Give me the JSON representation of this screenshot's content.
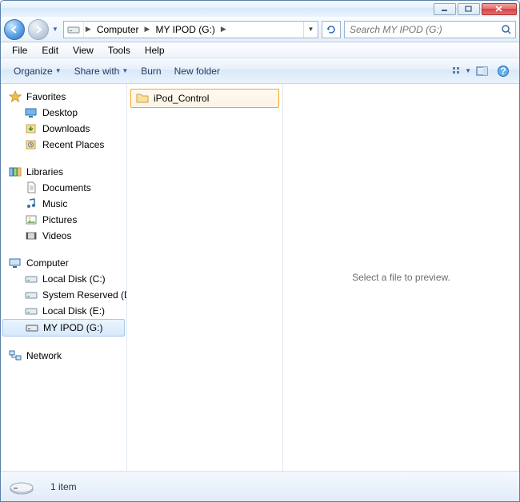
{
  "window_controls": {
    "min": "minimize",
    "max": "maximize",
    "close": "close"
  },
  "address": {
    "segments": [
      "Computer",
      "MY IPOD (G:)"
    ]
  },
  "search": {
    "placeholder": "Search MY IPOD (G:)"
  },
  "menubar": {
    "file": "File",
    "edit": "Edit",
    "view": "View",
    "tools": "Tools",
    "help": "Help"
  },
  "toolbar": {
    "organize": "Organize",
    "share": "Share with",
    "burn": "Burn",
    "newfolder": "New folder"
  },
  "sidebar": {
    "favorites": {
      "label": "Favorites",
      "items": [
        {
          "icon": "desktop",
          "label": "Desktop"
        },
        {
          "icon": "downloads",
          "label": "Downloads"
        },
        {
          "icon": "recent",
          "label": "Recent Places"
        }
      ]
    },
    "libraries": {
      "label": "Libraries",
      "items": [
        {
          "icon": "documents",
          "label": "Documents"
        },
        {
          "icon": "music",
          "label": "Music"
        },
        {
          "icon": "pictures",
          "label": "Pictures"
        },
        {
          "icon": "videos",
          "label": "Videos"
        }
      ]
    },
    "computer": {
      "label": "Computer",
      "items": [
        {
          "icon": "hdd",
          "label": "Local Disk (C:)"
        },
        {
          "icon": "hdd",
          "label": "System Reserved (D:"
        },
        {
          "icon": "hdd",
          "label": "Local Disk (E:)"
        },
        {
          "icon": "drive",
          "label": "MY IPOD (G:)",
          "selected": true
        }
      ]
    },
    "network": {
      "label": "Network"
    }
  },
  "files": [
    {
      "icon": "folder",
      "label": "iPod_Control",
      "selected": true
    }
  ],
  "preview": {
    "message": "Select a file to preview."
  },
  "status": {
    "count": "1 item"
  }
}
